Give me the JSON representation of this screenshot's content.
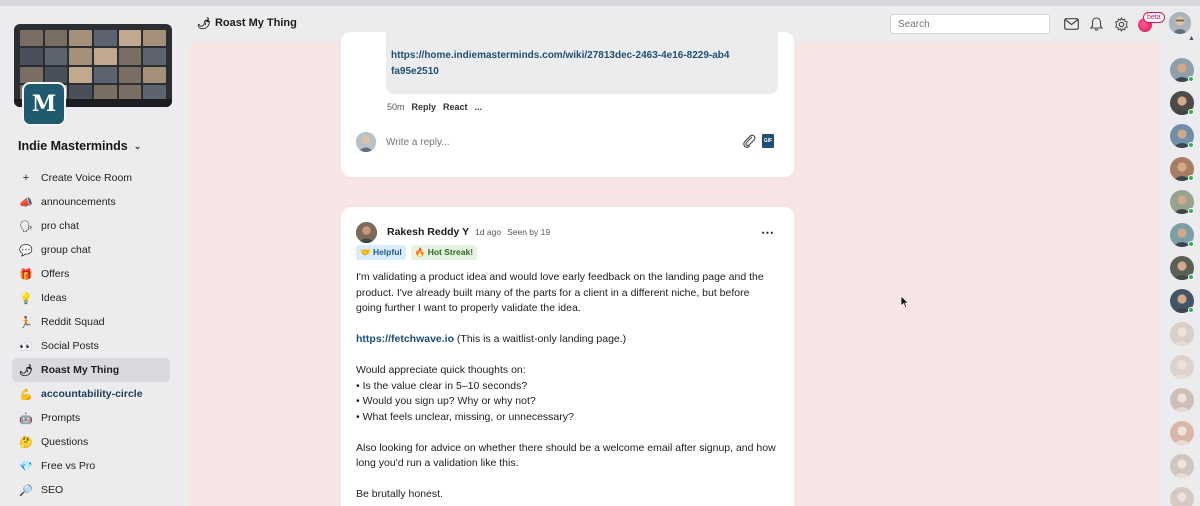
{
  "community": {
    "name": "Indie Masterminds",
    "logo_letter": "M",
    "logo_icon": "m-logo-icon"
  },
  "sidebar": {
    "channels": [
      {
        "icon": "+",
        "icon_name": "plus-icon",
        "label": "Create Voice Room",
        "active": false,
        "bold": false
      },
      {
        "icon": "📣",
        "icon_name": "megaphone-icon",
        "label": "announcements",
        "active": false,
        "bold": false
      },
      {
        "icon": "🗣",
        "icon_name": "speaking-head-icon",
        "label": "pro chat",
        "active": false,
        "bold": false
      },
      {
        "icon": "💬",
        "icon_name": "speech-bubble-icon",
        "label": "group chat",
        "active": false,
        "bold": false
      },
      {
        "icon": "🎁",
        "icon_name": "gift-icon",
        "label": "Offers",
        "active": false,
        "bold": false
      },
      {
        "icon": "💡",
        "icon_name": "lightbulb-icon",
        "label": "Ideas",
        "active": false,
        "bold": false
      },
      {
        "icon": "🏃",
        "icon_name": "runner-icon",
        "label": "Reddit Squad",
        "active": false,
        "bold": false
      },
      {
        "icon": "👀",
        "icon_name": "eyes-icon",
        "label": "Social Posts",
        "active": false,
        "bold": false
      },
      {
        "icon": "🌶",
        "icon_name": "chili-pepper-icon",
        "label": "Roast My Thing",
        "active": true,
        "bold": false
      },
      {
        "icon": "💪",
        "icon_name": "flexed-biceps-icon",
        "label": "accountability-circle",
        "active": false,
        "bold": true
      },
      {
        "icon": "🤖",
        "icon_name": "robot-icon",
        "label": "Prompts",
        "active": false,
        "bold": false
      },
      {
        "icon": "🤔",
        "icon_name": "thinking-face-icon",
        "label": "Questions",
        "active": false,
        "bold": false
      },
      {
        "icon": "💎",
        "icon_name": "gem-icon",
        "label": "Free vs Pro",
        "active": false,
        "bold": false
      },
      {
        "icon": "🔎",
        "icon_name": "magnifier-icon",
        "label": "SEO",
        "active": false,
        "bold": false
      }
    ]
  },
  "header": {
    "room_icon": "🌶",
    "room_title": "Roast My Thing",
    "search_placeholder": "Search",
    "beta_label": "beta"
  },
  "previous_post": {
    "quote_link": "https://home.indiemasterminds.com/wiki/27813dec-2463-4e16-8229-ab4fa95e2510",
    "time": "50m",
    "reply_label": "Reply",
    "react_label": "React",
    "more_label": "...",
    "reply_placeholder": "Write a reply..."
  },
  "post": {
    "author": "Rakesh Reddy Y",
    "time": "1d ago",
    "seen": "Seen by 19",
    "badges": {
      "helpful": "🤝 Helpful",
      "streak": "🔥 Hot Streak!"
    },
    "body": {
      "p1": "I'm validating a product idea and would love early feedback on the landing page and the product. I've already built many of the parts for a client in a different niche, but before going further I want to properly validate the idea.",
      "link": "https://fetchwave.io",
      "link_note": " (This is a waitlist-only landing page.)",
      "p3_intro": "Would appreciate quick thoughts on:",
      "bullet1": "• Is the value clear in 5–10 seconds?",
      "bullet2": "• Would you sign up? Why or why not?",
      "bullet3": "• What feels unclear, missing, or unnecessary?",
      "p4": "Also looking for advice on whether there should be a welcome email after signup, and how long you'd run a validation like this.",
      "p5": "Be brutally honest."
    }
  },
  "colors": {
    "feed_bg": "#f7e4e4",
    "link": "#1d4f73",
    "online": "#2fb24a"
  }
}
